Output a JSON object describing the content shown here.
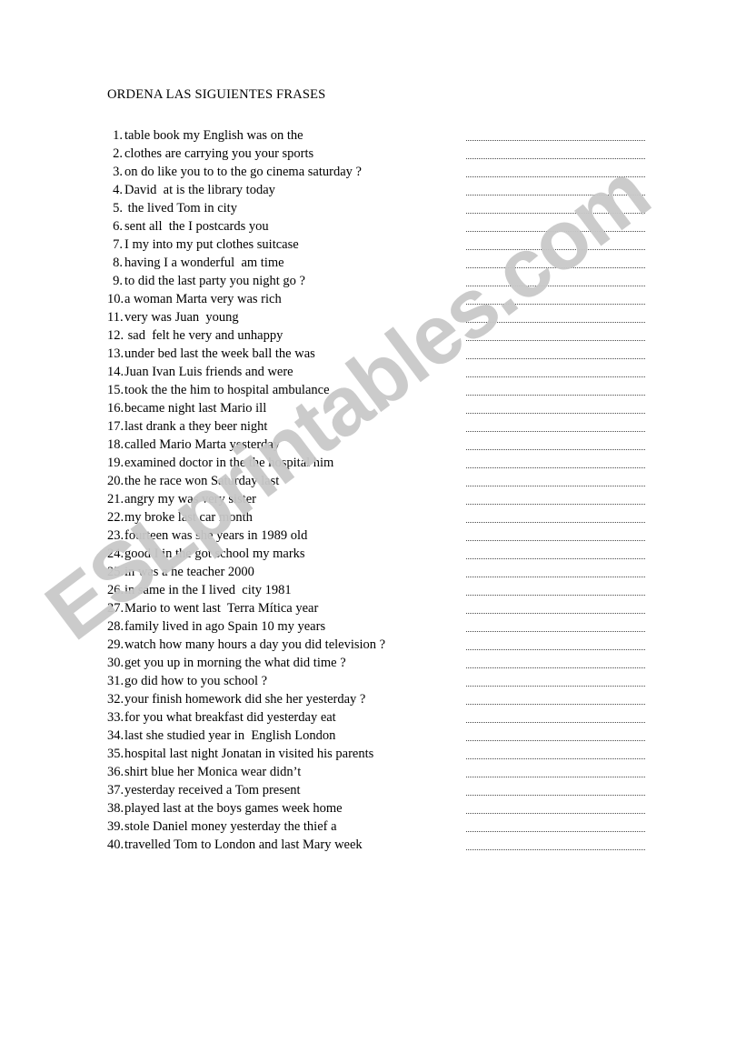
{
  "document": {
    "title": "ORDENA LAS SIGUIENTES FRASES",
    "watermark": "ESLprintables.com",
    "watermark_color": "#c9c9c9",
    "page_background": "#ffffff",
    "text_color": "#000000"
  },
  "exercise": {
    "items": [
      {
        "number": "1.",
        "text": "table book my English was on the"
      },
      {
        "number": "2.",
        "text": "clothes are carrying you your sports"
      },
      {
        "number": "3.",
        "text": "on do like you to to the go cinema saturday ?"
      },
      {
        "number": "4.",
        "text": "David  at is the library today"
      },
      {
        "number": "5.",
        "text": " the lived Tom in city"
      },
      {
        "number": "6.",
        "text": "sent all  the I postcards you"
      },
      {
        "number": "7.",
        "text": "I my into my put clothes suitcase"
      },
      {
        "number": "8.",
        "text": "having I a wonderful  am time"
      },
      {
        "number": "9.",
        "text": "to did the last party you night go ?"
      },
      {
        "number": "10.",
        "text": "a woman Marta very was rich"
      },
      {
        "number": "11.",
        "text": "very was Juan  young"
      },
      {
        "number": "12.",
        "text": " sad  felt he very and unhappy"
      },
      {
        "number": "13.",
        "text": "under bed last the week ball the was"
      },
      {
        "number": "14.",
        "text": "Juan Ivan Luis friends and were"
      },
      {
        "number": "15.",
        "text": "took the the him to hospital ambulance"
      },
      {
        "number": "16.",
        "text": "became night last Mario ill"
      },
      {
        "number": "17.",
        "text": "last drank a they beer night"
      },
      {
        "number": "18.",
        "text": "called Mario Marta yesterday"
      },
      {
        "number": "19.",
        "text": "examined doctor in the the hospital him"
      },
      {
        "number": "20.",
        "text": "the he race won Saturday last"
      },
      {
        "number": "21.",
        "text": "angry my was very sister"
      },
      {
        "number": "22.",
        "text": "my broke last car month"
      },
      {
        "number": "23.",
        "text": "fourteen was she years in 1989 old"
      },
      {
        "number": "24.",
        "text": "good I in the got school my marks"
      },
      {
        "number": "25.",
        "text": "in was a he teacher 2000"
      },
      {
        "number": "26.",
        "text": "in same in the I lived  city 1981"
      },
      {
        "number": "27.",
        "text": "Mario to went last  Terra Mítica year"
      },
      {
        "number": "28.",
        "text": "family lived in ago Spain 10 my years"
      },
      {
        "number": "29.",
        "text": "watch how many hours a day you did television ?"
      },
      {
        "number": "30.",
        "text": "get you up in morning the what did time ?"
      },
      {
        "number": "31.",
        "text": "go did how to you school ?"
      },
      {
        "number": "32.",
        "text": "your finish homework did she her yesterday ?"
      },
      {
        "number": "33.",
        "text": "for you what breakfast did yesterday eat"
      },
      {
        "number": "34.",
        "text": "last she studied year in  English London"
      },
      {
        "number": "35.",
        "text": "hospital last night Jonatan in visited his parents"
      },
      {
        "number": "36.",
        "text": "shirt blue her Monica wear didn’t"
      },
      {
        "number": "37.",
        "text": "yesterday received a Tom present"
      },
      {
        "number": "38.",
        "text": "played last at the boys games week home"
      },
      {
        "number": "39.",
        "text": "stole Daniel money yesterday the thief a"
      },
      {
        "number": "40.",
        "text": "travelled Tom to London and last Mary week"
      }
    ]
  }
}
